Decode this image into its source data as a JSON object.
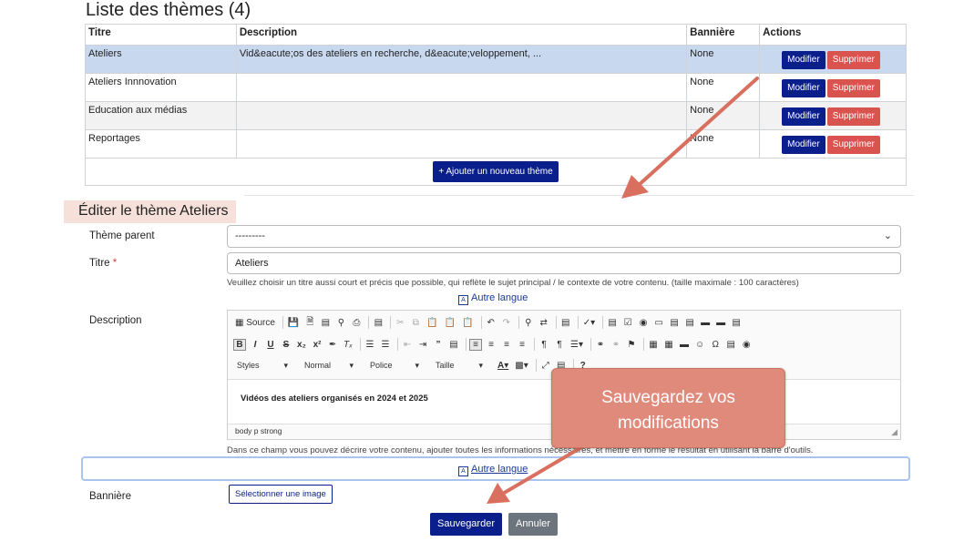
{
  "list": {
    "title": "Liste des thèmes (4)",
    "headers": {
      "title": "Titre",
      "description": "Description",
      "banner": "Bannière",
      "actions": "Actions"
    },
    "rows": [
      {
        "title": "Ateliers",
        "description": "Vid&eacute;os des ateliers en recherche, d&eacute;veloppement, ...",
        "banner": "None"
      },
      {
        "title": "Ateliers Innnovation",
        "description": "",
        "banner": "None"
      },
      {
        "title": "Education aux médias",
        "description": "",
        "banner": "None"
      },
      {
        "title": "Reportages",
        "description": "",
        "banner": "None"
      }
    ],
    "modify_label": "Modifier",
    "delete_label": "Supprimer",
    "add_label": "+ Ajouter un nouveau thème"
  },
  "edit": {
    "title": "Éditer le thème Ateliers",
    "parent_label": "Thème parent",
    "parent_value": "---------",
    "title_label": "Titre",
    "required_mark": "*",
    "title_value": "Ateliers",
    "title_help": "Veuillez choisir un titre aussi court et précis que possible, qui reflète le sujet principal / le contexte de votre contenu. (taille maximale : 100 caractères)",
    "other_language": "Autre langue",
    "description_label": "Description",
    "description_content": "Vidéos des ateliers organisés en 2024 et 2025",
    "editor_path": "body  p  strong",
    "description_help": "Dans ce champ vous pouvez décrire votre contenu, ajouter toutes les informations nécessaires, et mettre en forme le résultat en utilisant la barre d'outils.",
    "banner_label": "Bannière",
    "select_image": "Sélectionner une image",
    "save": "Sauvegarder",
    "cancel": "Annuler"
  },
  "editor_toolbar": {
    "source": "Source",
    "styles": "Styles",
    "format": "Normal",
    "font": "Police",
    "size": "Taille"
  },
  "callout": {
    "text": "Sauvegardez vos modifications"
  },
  "colors": {
    "primary": "#0a1e8c",
    "danger": "#d9534f",
    "secondary": "#6c757d",
    "callout": "#e08a7c",
    "selected_row": "#c8d8ef"
  }
}
